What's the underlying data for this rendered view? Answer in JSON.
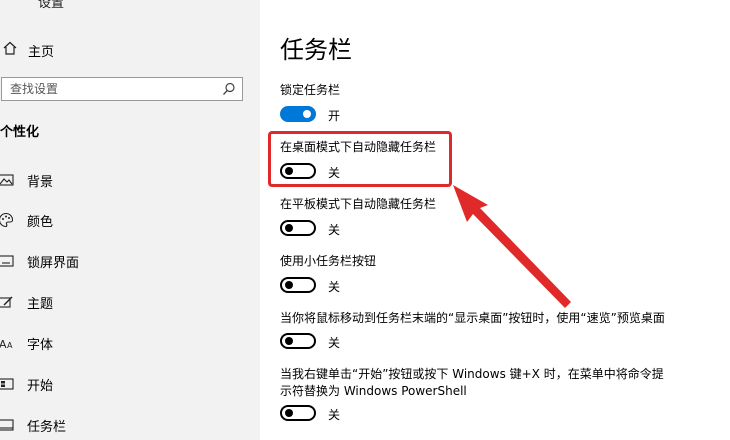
{
  "window": {
    "title": "设置"
  },
  "sidebar": {
    "home_label": "主页",
    "search": {
      "placeholder": "查找设置"
    },
    "section_title": "个性化",
    "items": [
      {
        "label": "背景",
        "icon": "image-icon"
      },
      {
        "label": "颜色",
        "icon": "palette-icon"
      },
      {
        "label": "锁屏界面",
        "icon": "lock-screen-icon"
      },
      {
        "label": "主题",
        "icon": "theme-brush-icon"
      },
      {
        "label": "字体",
        "icon": "font-icon"
      },
      {
        "label": "开始",
        "icon": "start-grid-icon"
      },
      {
        "label": "任务栏",
        "icon": "taskbar-icon"
      }
    ]
  },
  "main": {
    "title": "任务栏",
    "settings": [
      {
        "label": "锁定任务栏",
        "state": "开",
        "on": true
      },
      {
        "label": "在桌面模式下自动隐藏任务栏",
        "state": "关",
        "on": false
      },
      {
        "label": "在平板模式下自动隐藏任务栏",
        "state": "关",
        "on": false
      },
      {
        "label": "使用小任务栏按钮",
        "state": "关",
        "on": false
      },
      {
        "label": "当你将鼠标移动到任务栏末端的“显示桌面”按钮时，使用“速览”预览桌面",
        "state": "关",
        "on": false
      },
      {
        "label_line1": "当我右键单击“开始”按钮或按下 Windows 键+X 时，在菜单中将命令提",
        "label_line2": "示符替换为 Windows PowerShell",
        "state": "关",
        "on": false
      }
    ]
  },
  "annotation_colors": {
    "highlight": "#e02a2a",
    "toggle_on": "#0078d7"
  }
}
